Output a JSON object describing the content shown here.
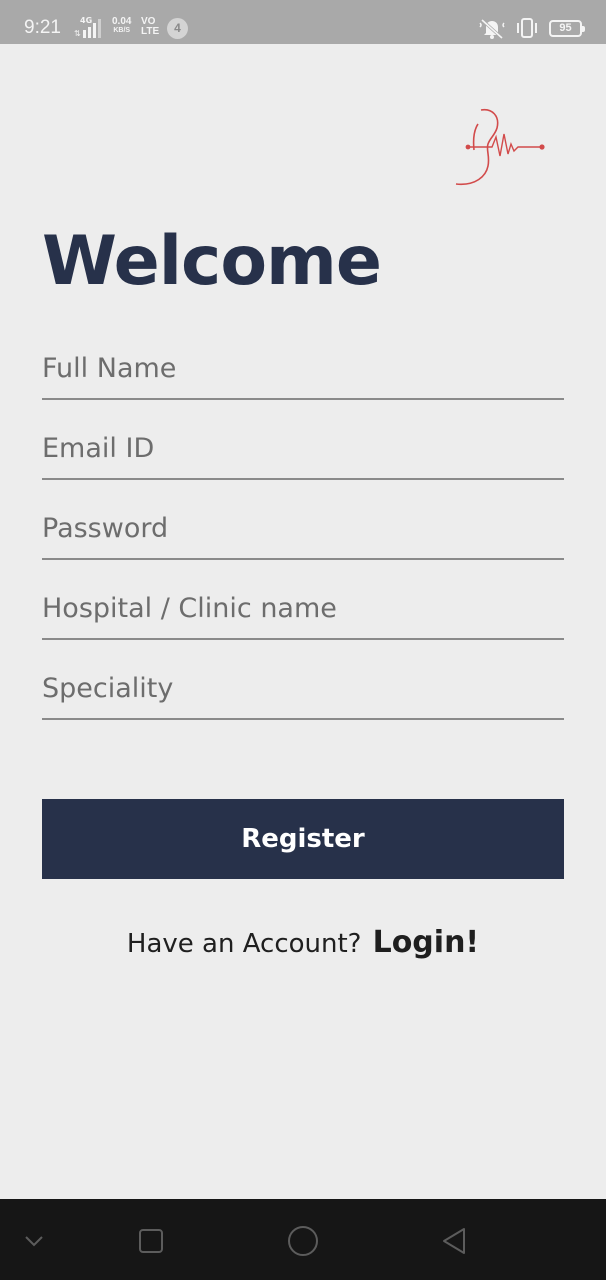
{
  "status_bar": {
    "time": "9:21",
    "network_type": "4G",
    "speed_value": "0.04",
    "speed_unit": "KB/S",
    "volte_top": "VO",
    "volte_bottom": "LTE",
    "notification_count": "4",
    "battery_level": "95"
  },
  "header": {
    "logo_icon": "ear-heartbeat-logo",
    "title": "Welcome"
  },
  "form": {
    "fields": [
      {
        "placeholder": "Full Name",
        "value": ""
      },
      {
        "placeholder": "Email ID",
        "value": ""
      },
      {
        "placeholder": "Password",
        "value": ""
      },
      {
        "placeholder": "Hospital / Clinic name",
        "value": ""
      },
      {
        "placeholder": "Speciality",
        "value": ""
      }
    ],
    "register_label": "Register"
  },
  "footer": {
    "question": "Have an Account?",
    "login_label": "Login!"
  },
  "colors": {
    "primary": "#27314a",
    "background": "#ededed",
    "status_bar": "#a9a9a9",
    "nav_bar": "#161616",
    "logo_accent": "#d24b4b"
  }
}
